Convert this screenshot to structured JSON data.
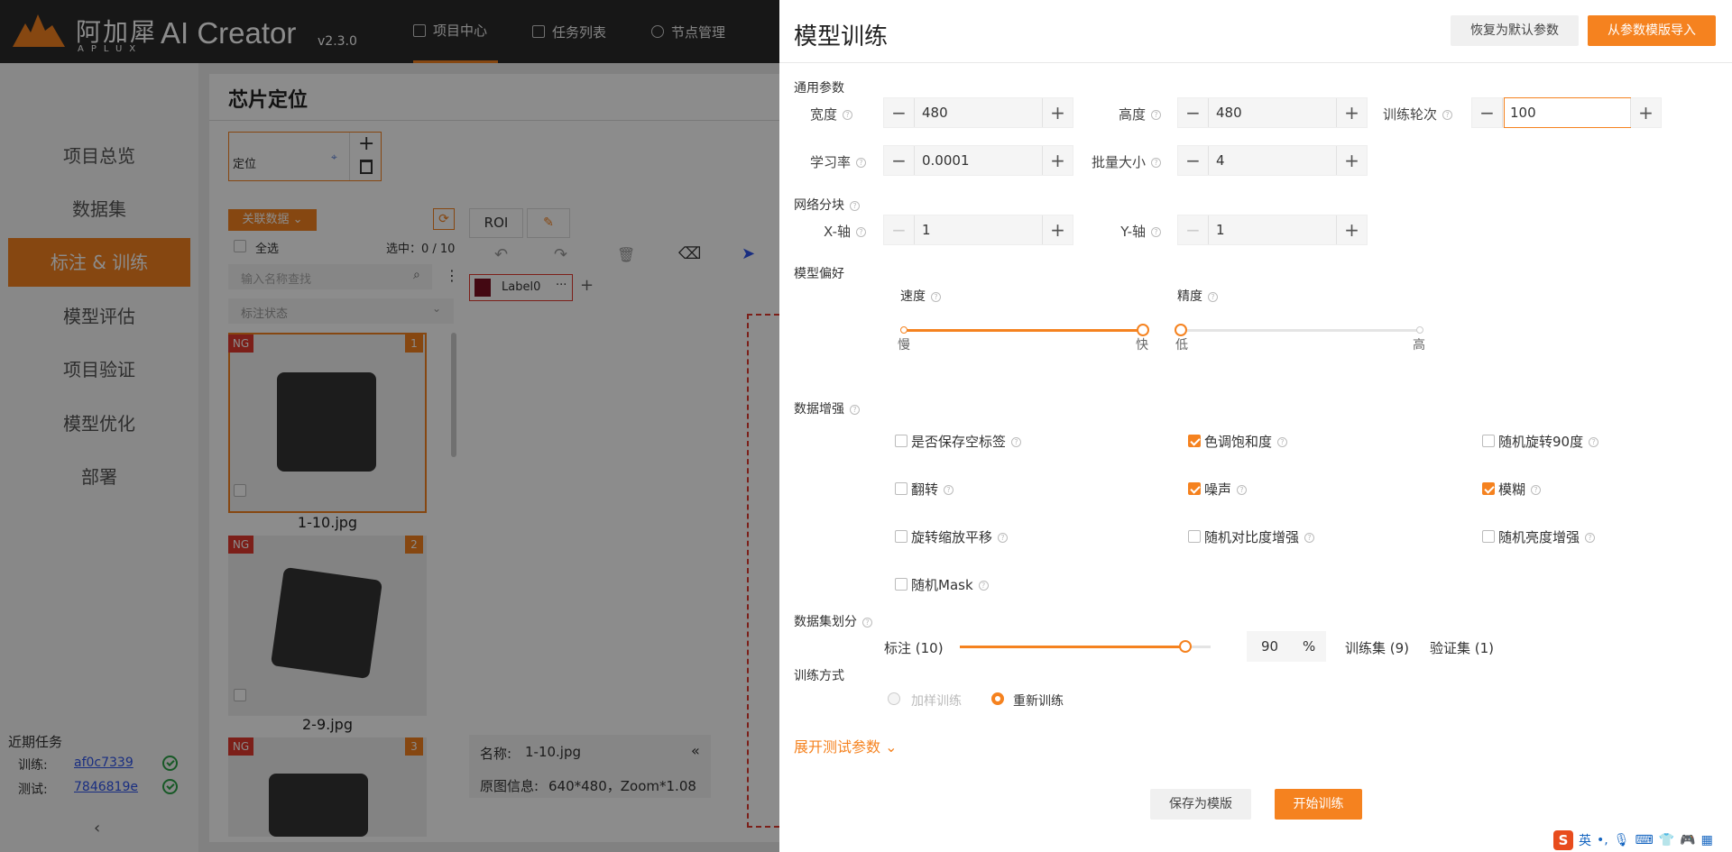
{
  "app": {
    "logo_cn": "阿加犀",
    "logo_en": "APLUX",
    "title": "AI Creator",
    "version": "v2.3.0",
    "top_nav": [
      {
        "label": "项目中心",
        "active": true
      },
      {
        "label": "任务列表",
        "active": false
      },
      {
        "label": "节点管理",
        "active": false
      }
    ]
  },
  "sidebar": {
    "items": [
      {
        "label": "项目总览"
      },
      {
        "label": "数据集"
      },
      {
        "label": "标注 & 训练",
        "active": true
      },
      {
        "label": "模型评估"
      },
      {
        "label": "项目验证"
      },
      {
        "label": "模型优化"
      },
      {
        "label": "部署"
      }
    ],
    "recent_title": "近期任务",
    "recent": [
      {
        "label": "训练:",
        "id": "af0c7339"
      },
      {
        "label": "测试:",
        "id": "7846819e"
      }
    ]
  },
  "main": {
    "page_title": "芯片定位",
    "roi_card_label": "定位",
    "link_data_button": "关联数据",
    "select_all": "全选",
    "selected_count": "选中：0 / 10",
    "search_placeholder": "输入名称查找",
    "status_filter": "标注状态",
    "tab_roi": "ROI",
    "label_chip": "Label0",
    "thumbnails": [
      {
        "badge": "NG",
        "index": "1",
        "name": "1-10.jpg",
        "selected": true
      },
      {
        "badge": "NG",
        "index": "2",
        "name": "2-9.jpg",
        "selected": false
      },
      {
        "badge": "NG",
        "index": "3",
        "name": "",
        "selected": false
      }
    ],
    "info_name_label": "名称:",
    "info_name_value": "1-10.jpg",
    "info_orig_label": "原图信息:",
    "info_orig_value": "640*480，Zoom*1.08"
  },
  "drawer": {
    "title": "模型训练",
    "reset_button": "恢复为默认参数",
    "import_button": "从参数模版导入",
    "general_section": "通用参数",
    "params": {
      "width": {
        "label": "宽度",
        "value": "480"
      },
      "height": {
        "label": "高度",
        "value": "480"
      },
      "epochs": {
        "label": "训练轮次",
        "value": "100"
      },
      "lr": {
        "label": "学习率",
        "value": "0.0001"
      },
      "batch": {
        "label": "批量大小",
        "value": "4"
      }
    },
    "grid_section": "网络分块",
    "grid": {
      "x": {
        "label": "X-轴",
        "value": "1"
      },
      "y": {
        "label": "Y-轴",
        "value": "1"
      }
    },
    "preference_section": "模型偏好",
    "speed": {
      "label": "速度",
      "min": "慢",
      "max": "快",
      "value": 1.0
    },
    "accuracy": {
      "label": "精度",
      "min": "低",
      "max": "高",
      "value": 0.0
    },
    "augment_section": "数据增强",
    "augmentations": [
      {
        "label": "是否保存空标签",
        "checked": false
      },
      {
        "label": "色调饱和度",
        "checked": true
      },
      {
        "label": "随机旋转90度",
        "checked": false
      },
      {
        "label": "翻转",
        "checked": false
      },
      {
        "label": "噪声",
        "checked": true
      },
      {
        "label": "模糊",
        "checked": true
      },
      {
        "label": "旋转缩放平移",
        "checked": false
      },
      {
        "label": "随机对比度增强",
        "checked": false
      },
      {
        "label": "随机亮度增强",
        "checked": false
      },
      {
        "label": "随机Mask",
        "checked": false
      }
    ],
    "split_section": "数据集划分",
    "split": {
      "annotated": "标注 (10)",
      "percent": "90",
      "percent_unit": "%",
      "train": "训练集 (9)",
      "val": "验证集 (1)",
      "fraction": 0.9
    },
    "mode_section": "训练方式",
    "modes": [
      {
        "label": "加样训练",
        "selected": false,
        "disabled": true
      },
      {
        "label": "重新训练",
        "selected": true,
        "disabled": false
      }
    ],
    "expand_link": "展开测试参数",
    "save_template_button": "保存为模版",
    "start_button": "开始训练"
  },
  "ime": {
    "label": "英"
  },
  "colors": {
    "accent": "#f5821f",
    "topbar": "#2b2b2b",
    "ng": "#e23a2e",
    "ok": "#2ba245"
  }
}
